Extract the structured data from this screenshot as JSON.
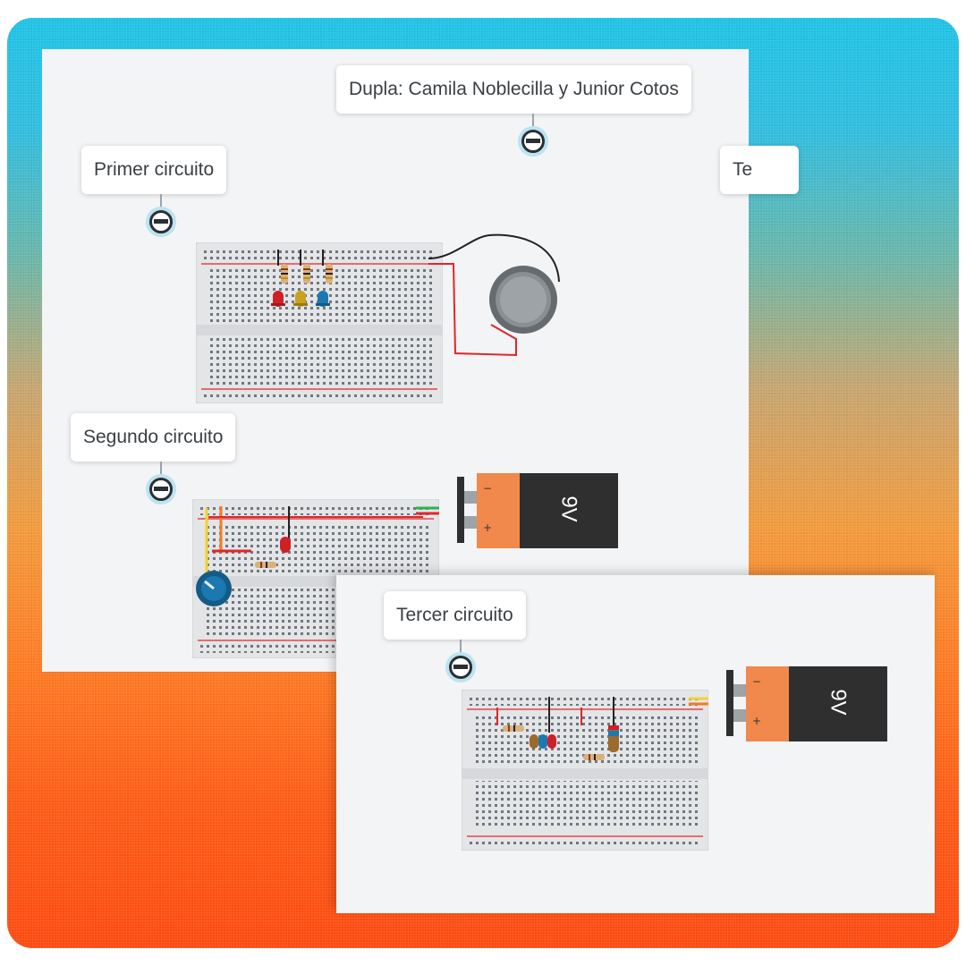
{
  "canvas": {
    "labels": {
      "dupla": "Dupla: Camila Noblecilla y Junior Cotos",
      "primer": "Primer circuito",
      "segundo": "Segundo circuito",
      "tercer": "Tercer circuito",
      "cut_label": "Te"
    },
    "battery_label": "9V",
    "battery_minus": "−",
    "battery_plus": "+",
    "colors": {
      "battery_orange": "#f0894b",
      "battery_dark": "#2f2f2f",
      "wire_red": "#e0262a",
      "wire_green": "#2bb24c",
      "wire_yellow": "#f2d22e",
      "wire_orange": "#f07d22",
      "led_red": "#cf2027",
      "led_yellow": "#c9a21f",
      "led_blue": "#1c78b0"
    },
    "icons": [
      "label-pin-icon",
      "breadboard-icon",
      "battery-9v-icon",
      "coin-cell-battery-icon",
      "potentiometer-icon",
      "led-icon",
      "resistor-icon"
    ]
  }
}
